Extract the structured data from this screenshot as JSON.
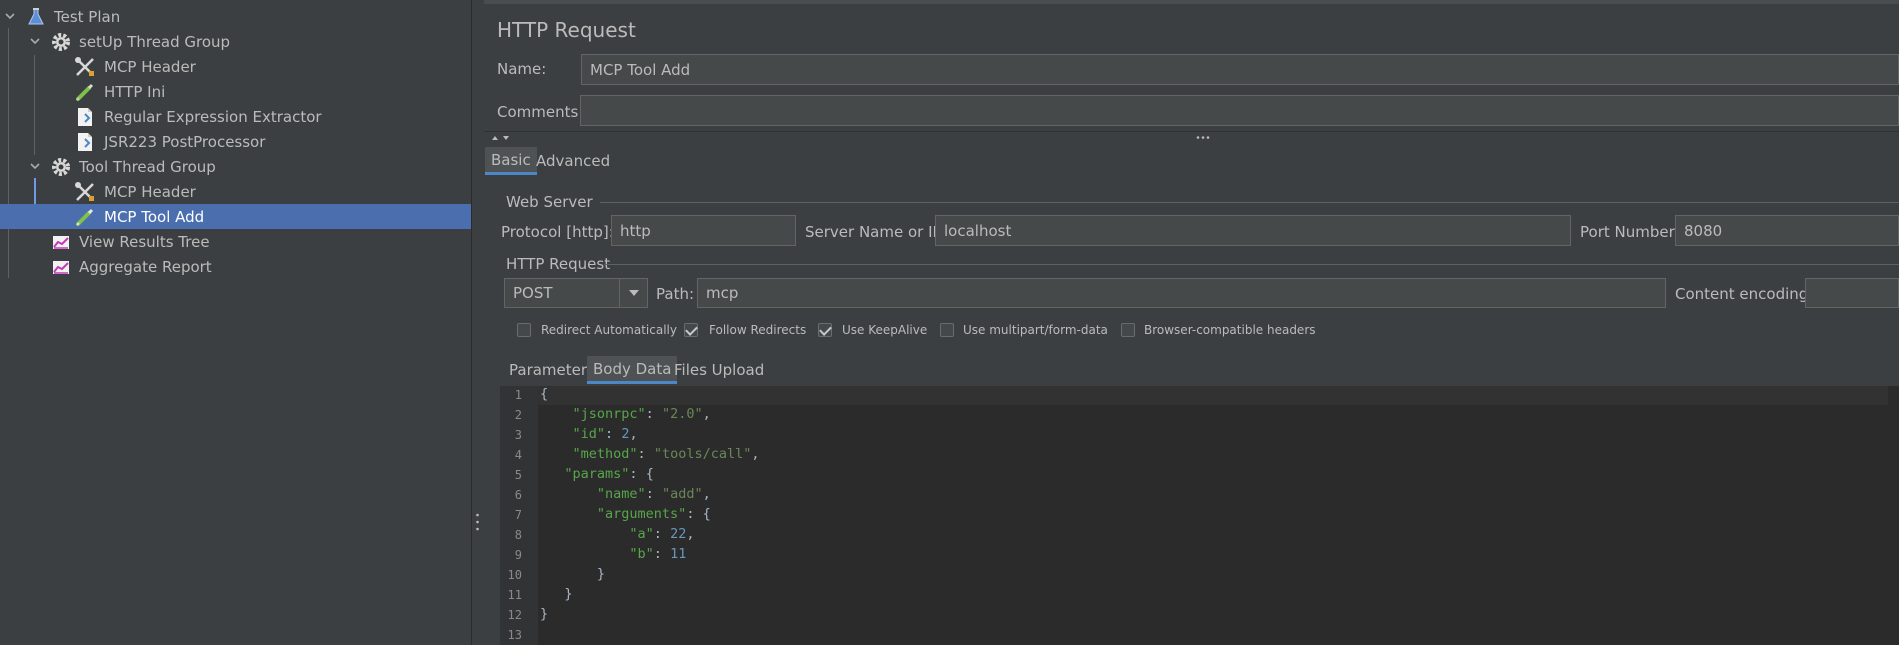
{
  "tree": {
    "items": [
      {
        "label": "Test Plan",
        "icon": "flask-icon"
      },
      {
        "label": "setUp Thread Group",
        "icon": "gear-icon"
      },
      {
        "label": "MCP Header",
        "icon": "wrench-screwdriver-icon"
      },
      {
        "label": "HTTP Ini",
        "icon": "pipette-icon"
      },
      {
        "label": "Regular Expression Extractor",
        "icon": "document-icon"
      },
      {
        "label": "JSR223 PostProcessor",
        "icon": "document-icon"
      },
      {
        "label": "Tool Thread Group",
        "icon": "gear-icon"
      },
      {
        "label": "MCP Header",
        "icon": "wrench-screwdriver-icon"
      },
      {
        "label": "MCP Tool Add",
        "icon": "pipette-icon"
      },
      {
        "label": "View Results Tree",
        "icon": "chart-icon"
      },
      {
        "label": "Aggregate Report",
        "icon": "chart-icon"
      }
    ],
    "selected_index": 8
  },
  "panel": {
    "title": "HTTP Request",
    "name_label": "Name:",
    "name_value": "MCP Tool Add",
    "comments_label": "Comments:",
    "comments_value": "",
    "tabs": [
      {
        "label": "Basic"
      },
      {
        "label": "Advanced"
      }
    ],
    "active_tab": "Basic"
  },
  "web_server": {
    "legend": "Web Server",
    "protocol_label": "Protocol [http]:",
    "protocol_value": "http",
    "server_label": "Server Name or IP:",
    "server_value": "localhost",
    "port_label": "Port Number:",
    "port_value": "8080"
  },
  "http_request": {
    "legend": "HTTP Request",
    "method_value": "POST",
    "path_label": "Path:",
    "path_value": "mcp",
    "encoding_label": "Content encoding:",
    "encoding_value": ""
  },
  "options": [
    {
      "label": "Redirect Automatically",
      "checked": false
    },
    {
      "label": "Follow Redirects",
      "checked": true
    },
    {
      "label": "Use KeepAlive",
      "checked": true
    },
    {
      "label": "Use multipart/form-data",
      "checked": false
    },
    {
      "label": "Browser-compatible headers",
      "checked": false
    }
  ],
  "sub_tabs": [
    {
      "label": "Parameters"
    },
    {
      "label": "Body Data"
    },
    {
      "label": "Files Upload"
    }
  ],
  "active_sub_tab": "Body Data",
  "editor": {
    "line_numbers": [
      "1",
      "2",
      "3",
      "4",
      "5",
      "6",
      "7",
      "8",
      "9",
      "10",
      "11",
      "12",
      "13"
    ],
    "lines": [
      "{",
      "    \"jsonrpc\": \"2.0\",",
      "    \"id\": 2,",
      "    \"method\": \"tools/call\",",
      "   \"params\": {",
      "       \"name\": \"add\",",
      "       \"arguments\": {",
      "           \"a\": 22,",
      "           \"b\": 11",
      "       }",
      "   }",
      "}",
      ""
    ]
  },
  "colors": {
    "selection": "#4b6eaf",
    "background": "#3c3f41",
    "editor_bg": "#2b2b2b",
    "string": "#6a8759",
    "number": "#6897bb"
  }
}
